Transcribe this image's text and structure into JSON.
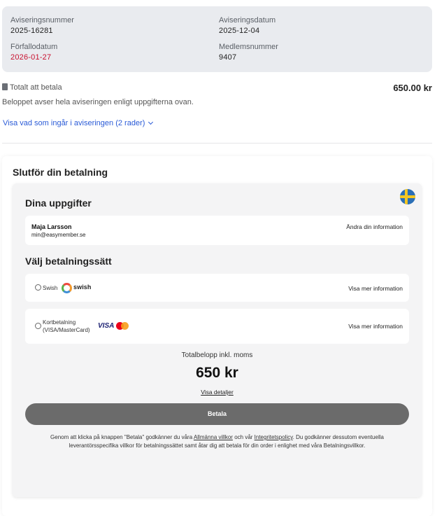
{
  "invoice_info": {
    "number_label": "Aviseringsnummer",
    "number_value": "2025-16281",
    "date_label": "Aviseringsdatum",
    "date_value": "2025-12-04",
    "due_label": "Förfallodatum",
    "due_value": "2026-01-27",
    "member_label": "Medlemsnummer",
    "member_value": "9407",
    "due_color": "#c8102e"
  },
  "summary": {
    "total_label": "Totalt att betala",
    "total_amount": "650.00 kr",
    "note": "Beloppet avser hela aviseringen enligt uppgifterna ovan.",
    "toggle_link": "Visa vad som ingår i aviseringen (2 rader)",
    "link_color": "#2a5bd7"
  },
  "checkout": {
    "title": "Slutför din betalning",
    "details_title": "Dina uppgifter",
    "user_name": "Maja Larsson",
    "user_email": "min@easymember.se",
    "change_info_link": "Ändra din information",
    "payment_method_title": "Välj betalningssätt",
    "flag_icon": "sweden-flag-icon",
    "methods": [
      {
        "label": "Swish",
        "brand": "swish",
        "more_link": "Visa mer information"
      },
      {
        "label_line1": "Kortbetalning",
        "label_line2": "(VISA/MasterCard)",
        "brand": "VISA",
        "more_link": "Visa mer information"
      }
    ],
    "total_incl_label": "Totalbelopp inkl. moms",
    "total_incl_amount": "650 kr",
    "details_link": "Visa detaljer",
    "pay_button": "Betala",
    "pay_button_color": "#6b6b6b",
    "terms_part1": "Genom att klicka på knappen \"Betala\" godkänner du våra ",
    "terms_link1": "Allmänna villkor",
    "terms_part2": " och vår ",
    "terms_link2": "Integritetspolicy",
    "terms_part3": ". Du godkänner dessutom eventuella leverantörsspecifika villkor för betalningssättet samt åtar dig att betala för din order i enlighet med våra Betalningsvillkor."
  }
}
